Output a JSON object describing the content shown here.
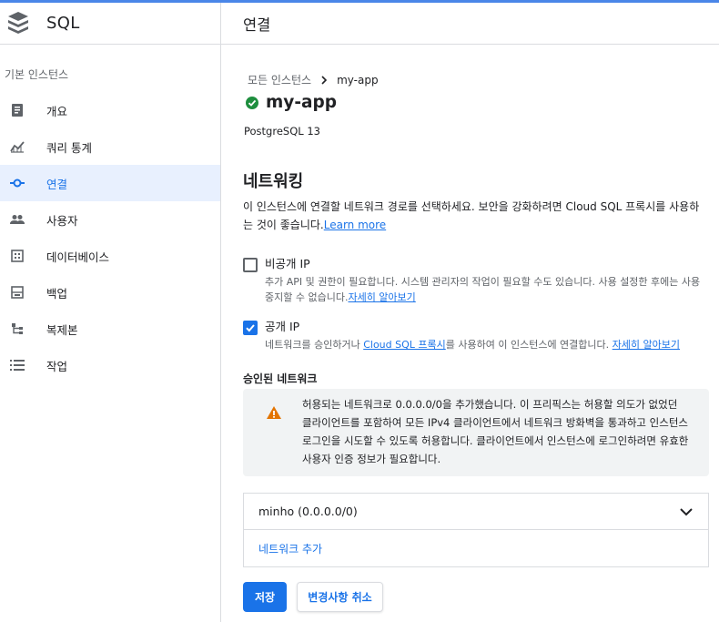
{
  "app": {
    "title": "SQL"
  },
  "colors": {
    "accent": "#1a73e8",
    "success": "#1e8e3e",
    "warning": "#e37400",
    "top_bar": "#4a86e8"
  },
  "sidebar": {
    "section_label": "기본 인스턴스",
    "items": [
      {
        "label": "개요",
        "icon": "overview-icon"
      },
      {
        "label": "쿼리 통계",
        "icon": "query-insights-icon"
      },
      {
        "label": "연결",
        "icon": "connections-icon",
        "active": true
      },
      {
        "label": "사용자",
        "icon": "users-icon"
      },
      {
        "label": "데이터베이스",
        "icon": "databases-icon"
      },
      {
        "label": "백업",
        "icon": "backups-icon"
      },
      {
        "label": "복제본",
        "icon": "replicas-icon"
      },
      {
        "label": "작업",
        "icon": "operations-icon"
      }
    ]
  },
  "header": {
    "title": "연결"
  },
  "breadcrumb": {
    "parent": "모든 인스턴스",
    "current": "my-app"
  },
  "instance": {
    "name": "my-app",
    "version": "PostgreSQL 13",
    "status": "running"
  },
  "networking": {
    "title": "네트워킹",
    "description": "이 인스턴스에 연결할 네트워크 경로를 선택하세요. 보안을 강화하려면 Cloud SQL 프록시를 사용하는 것이 좋습니다.",
    "learn_more": "Learn more",
    "private_ip": {
      "label": "비공개 IP",
      "checked": false,
      "help": "추가 API 및 권한이 필요합니다. 시스템 관리자의 작업이 필요할 수도 있습니다. 사용 설정한 후에는 사용 중지할 수 없습니다.",
      "link": "자세히 알아보기"
    },
    "public_ip": {
      "label": "공개 IP",
      "checked": true,
      "help_prefix": "네트워크를 승인하거나 ",
      "help_link": "Cloud SQL 프록시",
      "help_suffix": "를 사용하여 이 인스턴스에 연결합니다. ",
      "link": "자세히 알아보기"
    },
    "authorized_title": "승인된 네트워크",
    "warning": "허용되는 네트워크로 0.0.0.0/0을 추가했습니다. 이 프리픽스는 허용할 의도가 없었던 클라이언트를 포함하여 모든 IPv4 클라이언트에서 네트워크 방화벽을 통과하고 인스턴스 로그인을 시도할 수 있도록 허용합니다. 클라이언트에서 인스턴스에 로그인하려면 유효한 사용자 인증 정보가 필요합니다.",
    "networks": [
      {
        "label": "minho (0.0.0.0/0)"
      }
    ],
    "add_network": "네트워크 추가"
  },
  "actions": {
    "save": "저장",
    "cancel": "변경사항 취소"
  }
}
